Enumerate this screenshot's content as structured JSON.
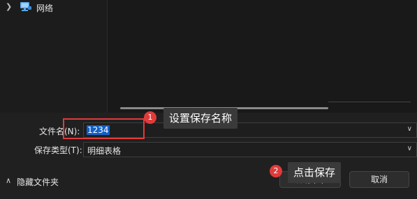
{
  "nav": {
    "items": [
      {
        "label": "网络",
        "icon": "network-icon"
      }
    ]
  },
  "form": {
    "filename_label": "文件名(N):",
    "filename_value": "1234",
    "type_label": "保存类型(T):",
    "type_value": "明细表格"
  },
  "footer": {
    "hide_folders_label": "隐藏文件夹",
    "save_label": "保存(S)",
    "cancel_label": "取消"
  },
  "annotations": [
    {
      "number": "1",
      "text": "设置保存名称"
    },
    {
      "number": "2",
      "text": "点击保存"
    }
  ],
  "colors": {
    "annotation_red": "#e23a3a",
    "selection_blue": "#1360c6",
    "tooltip_bg": "#3a3a3a"
  }
}
